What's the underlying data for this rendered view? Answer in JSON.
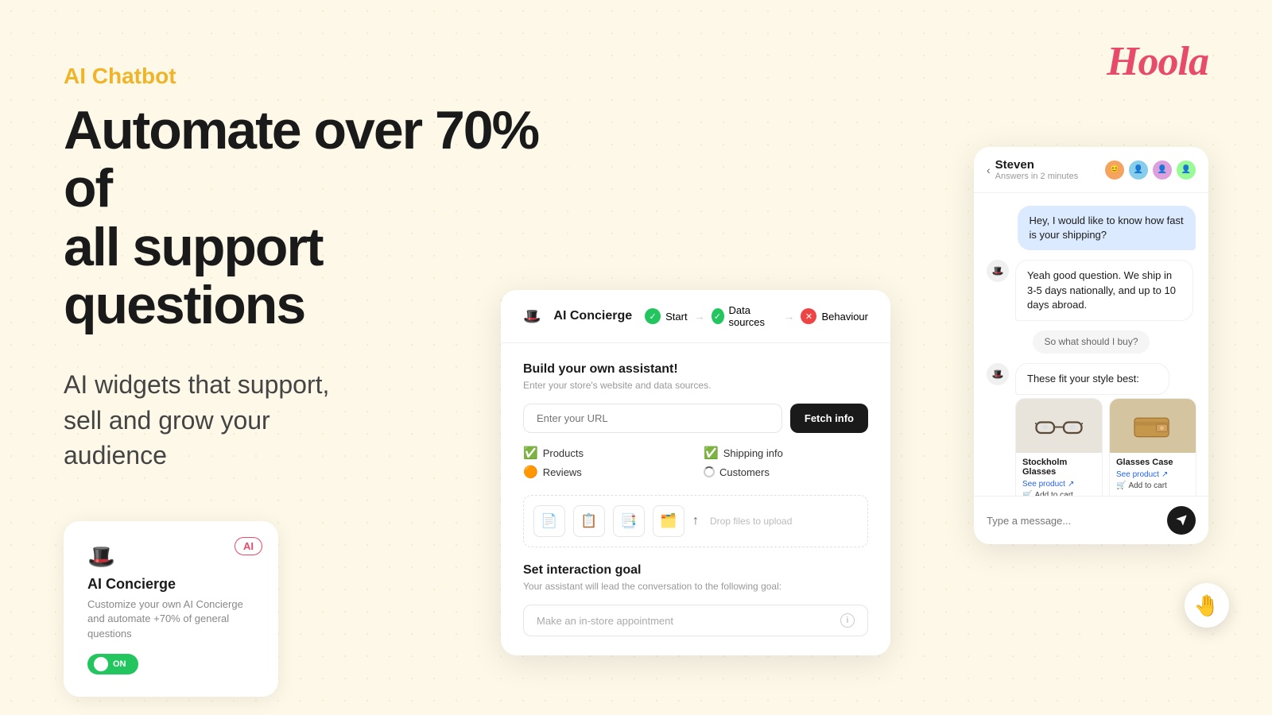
{
  "logo": {
    "text": "Hoola"
  },
  "hero": {
    "badge": "AI Chatbot",
    "headline_line1": "Automate over 70% of",
    "headline_line2": "all support questions",
    "subheadline": "AI widgets that support,\nsell and grow your\naudience"
  },
  "widget_card": {
    "icon": "🎩",
    "ai_badge": "AI",
    "title": "AI Concierge",
    "description": "Customize your own AI Concierge and automate +70% of general questions",
    "toggle_label": "ON"
  },
  "builder_panel": {
    "header_icon": "🎩",
    "header_title": "AI Concierge",
    "steps": [
      {
        "label": "Start",
        "status": "green"
      },
      {
        "label": "Data sources",
        "status": "green"
      },
      {
        "label": "Behaviour",
        "status": "red"
      }
    ],
    "section_title": "Build your own assistant!",
    "section_sub": "Enter your store's website and data sources.",
    "url_placeholder": "Enter your URL",
    "fetch_button": "Fetch info",
    "checklist": [
      {
        "label": "Products",
        "status": "green"
      },
      {
        "label": "Shipping info",
        "status": "green"
      },
      {
        "label": "Reviews",
        "status": "orange"
      },
      {
        "label": "Customers",
        "status": "loading"
      }
    ],
    "upload_icons": [
      "📄",
      "📋",
      "📑",
      "🗂️"
    ],
    "upload_placeholder": "Drop files to upload",
    "interaction_title": "Set interaction goal",
    "interaction_sub": "Your assistant will lead the conversation to the following goal:",
    "interaction_placeholder": "Make an in-store appointment"
  },
  "chat_panel": {
    "agent_name": "Steven",
    "agent_status": "Answers in 2 minutes",
    "messages": [
      {
        "type": "user",
        "text": "Hey, I would like to know how fast is your shipping?"
      },
      {
        "type": "bot",
        "text": "Yeah good question. We ship in 3-5 days nationally, and up to 10 days abroad."
      },
      {
        "type": "center",
        "text": "So what should I buy?"
      },
      {
        "type": "bot",
        "text": "These fit your style best:"
      }
    ],
    "products": [
      {
        "name": "Stockholm Glasses",
        "see_product": "See product",
        "add_to_cart": "Add to cart"
      },
      {
        "name": "Glasses Case",
        "see_product": "See product",
        "add_to_cart": "Add to cart"
      }
    ],
    "input_placeholder": "Type a message..."
  }
}
